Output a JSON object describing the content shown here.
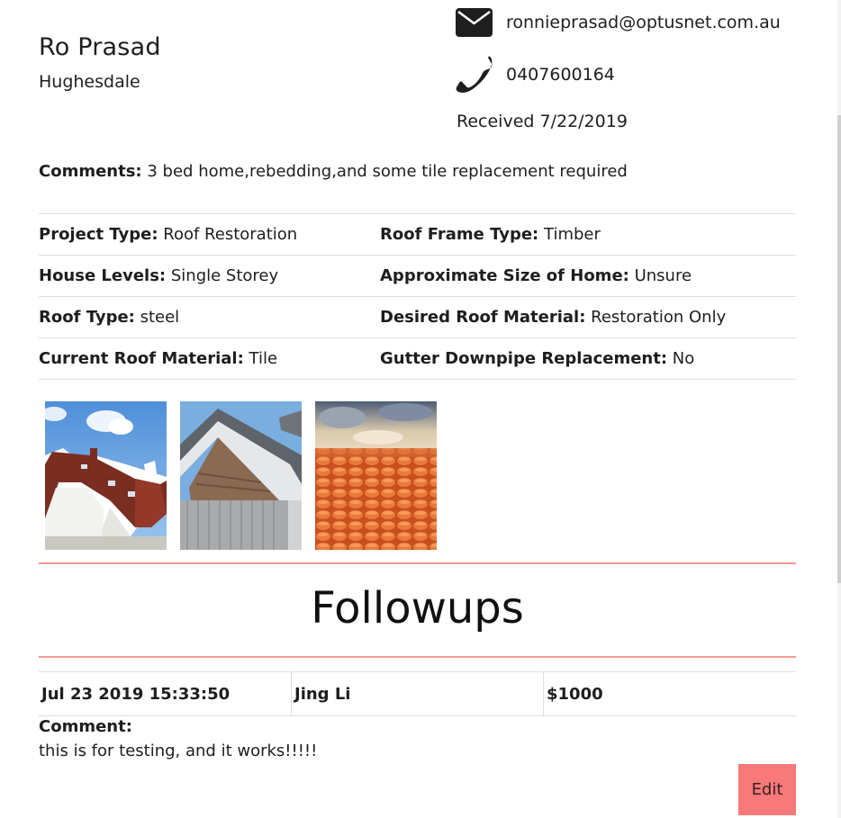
{
  "customer": {
    "name": "Ro Prasad",
    "suburb": "Hughesdale"
  },
  "contact": {
    "email": "ronnieprasad@optusnet.com.au",
    "phone": "0407600164",
    "received": "Received 7/22/2019",
    "email_icon": "envelope-icon",
    "phone_icon": "phone-icon"
  },
  "comments": {
    "label": "Comments:",
    "value": "3 bed home,rebedding,and some tile replacement required"
  },
  "details": [
    {
      "left_label": "Project Type:",
      "left_value": "Roof Restoration",
      "right_label": "Roof Frame Type:",
      "right_value": "Timber"
    },
    {
      "left_label": "House Levels:",
      "left_value": "Single Storey",
      "right_label": "Approximate Size of Home:",
      "right_value": "Unsure"
    },
    {
      "left_label": "Roof Type:",
      "left_value": "steel",
      "right_label": "Desired Roof Material:",
      "right_value": "Restoration Only"
    },
    {
      "left_label": "Current Roof Material:",
      "left_value": "Tile",
      "right_label": "Gutter Downpipe Replacement:",
      "right_value": "No"
    }
  ],
  "photos": [
    "house-roof-photo",
    "metal-gable-roof-photo",
    "terracotta-tiles-photo"
  ],
  "followups": {
    "title": "Followups",
    "entries": [
      {
        "date": "Jul 23 2019 15:33:50",
        "user": "Jing Li",
        "amount": "$1000",
        "comment_label": "Comment:",
        "comment": "this is for testing, and it works!!!!!"
      }
    ],
    "edit_label": "Edit"
  },
  "colors": {
    "accent": "#f7797a",
    "rule": "#f29a93",
    "border": "#dedede"
  }
}
